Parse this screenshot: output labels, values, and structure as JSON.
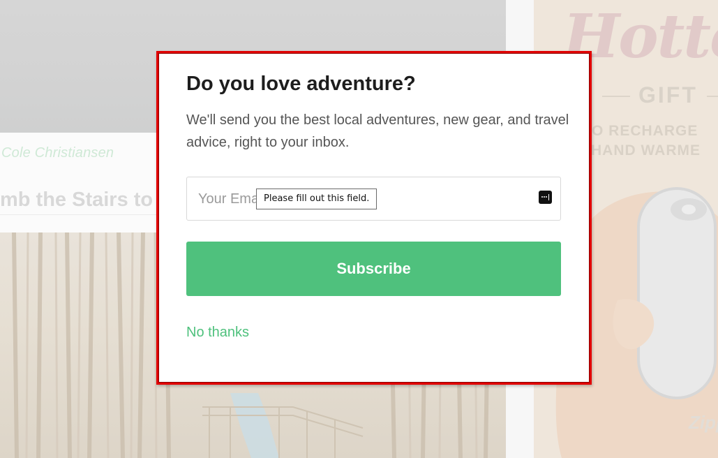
{
  "background": {
    "author": "Cole Christiansen",
    "article_title": "mb the Stairs to",
    "ad": {
      "script_text": "Hotte",
      "gift_label": "GIFT",
      "line1": "PO RECHARGE",
      "line2": "HAND WARME",
      "brand": "Zipp"
    }
  },
  "modal": {
    "title": "Do you love adventure?",
    "description": "We'll send you the best local adventures, new gear, and travel advice, right to your inbox.",
    "email": {
      "value": "",
      "placeholder": "Your Email",
      "validation_tooltip": "Please fill out this field."
    },
    "subscribe_label": "Subscribe",
    "dismiss_label": "No thanks"
  },
  "colors": {
    "accent_green": "#4fc17d",
    "highlight_border": "#e10000",
    "title": "#1d1d1d",
    "body_text": "#555555"
  },
  "icons": {
    "password_manager": "password-manager-icon"
  }
}
